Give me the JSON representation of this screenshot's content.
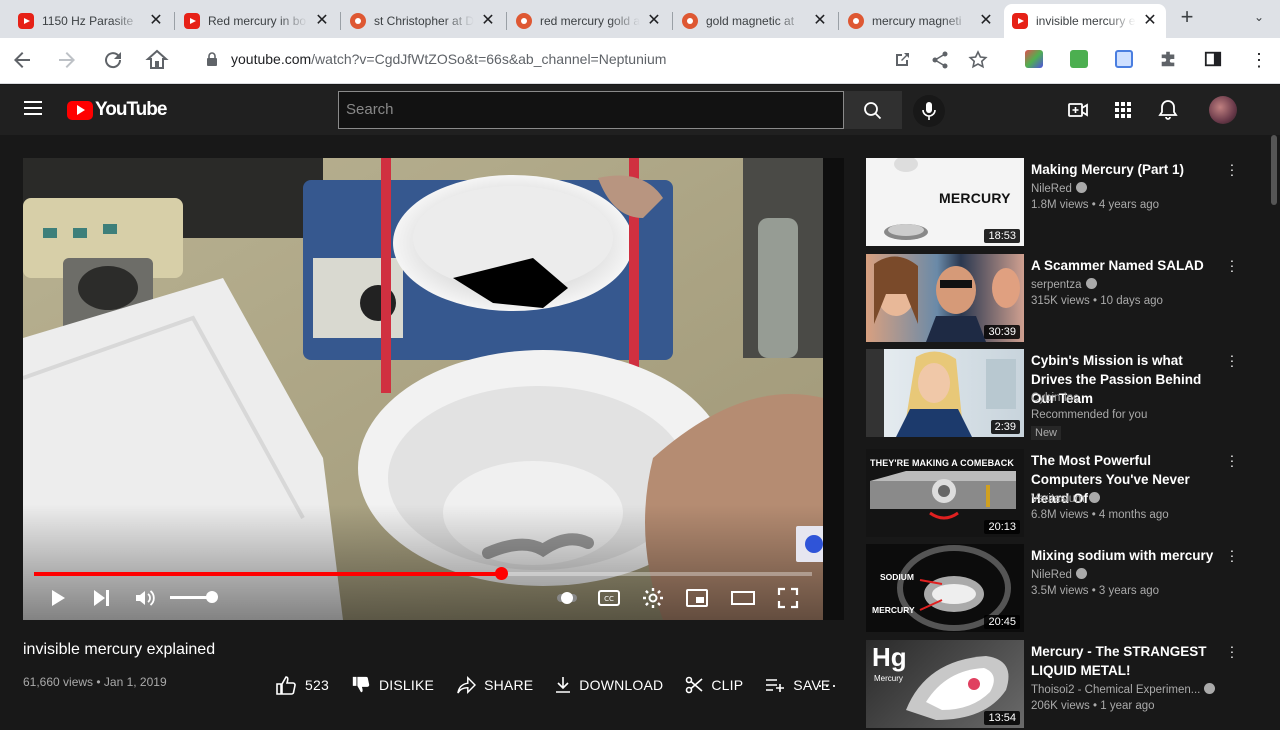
{
  "browser": {
    "tabs": [
      {
        "title": "1150 Hz Parasite",
        "icon": "youtube"
      },
      {
        "title": "Red mercury in bo",
        "icon": "youtube"
      },
      {
        "title": "st Christopher at D",
        "icon": "duckduckgo"
      },
      {
        "title": "red mercury gold a",
        "icon": "duckduckgo"
      },
      {
        "title": "gold magnetic at",
        "icon": "duckduckgo"
      },
      {
        "title": "mercury magneti",
        "icon": "duckduckgo"
      },
      {
        "title": "invisible mercury e",
        "icon": "youtube",
        "active": true
      }
    ],
    "url_host": "youtube.com",
    "url_rest": "/watch?v=CgdJfWtZOSo&t=66s&ab_channel=Neptunium"
  },
  "youtube": {
    "logo_text": "YouTube",
    "search_placeholder": "Search"
  },
  "video": {
    "title": "invisible mercury explained",
    "meta": "61,660 views • Jan 1, 2019",
    "progress": 0.6,
    "volume": 0.85,
    "actions": {
      "likes": "523",
      "dislike": "DISLIKE",
      "share": "SHARE",
      "download": "DOWNLOAD",
      "clip": "CLIP",
      "save": "SAVE"
    }
  },
  "recommendations": [
    {
      "title": "Making Mercury (Part 1)",
      "channel": "NileRed",
      "verified": true,
      "stats": "1.8M views • 4 years ago",
      "duration": "18:53",
      "thumb_text": "MERCURY"
    },
    {
      "title": "A Scammer Named SALAD",
      "channel": "serpentza",
      "verified": true,
      "stats": "315K views • 10 days ago",
      "duration": "30:39"
    },
    {
      "title": "Cybin's Mission is what Drives the Passion Behind Our Team",
      "channel": "Cybin Inc",
      "verified": false,
      "stats": "Recommended for you",
      "duration": "2:39",
      "badge": "New"
    },
    {
      "title": "The Most Powerful Computers You've Never Heard Of",
      "channel": "Veritasium",
      "verified": true,
      "stats": "6.8M views • 4 months ago",
      "duration": "20:13",
      "thumb_text": "THEY'RE MAKING A COMEBACK"
    },
    {
      "title": "Mixing sodium with mercury",
      "channel": "NileRed",
      "verified": true,
      "stats": "3.5M views • 3 years ago",
      "duration": "20:45",
      "thumb_text": "SODIUM",
      "thumb_text2": "MERCURY"
    },
    {
      "title": "Mercury - The STRANGEST LIQUID METAL!",
      "channel": "Thoisoi2 - Chemical Experimen...",
      "verified": true,
      "stats": "206K views • 1 year ago",
      "duration": "13:54",
      "thumb_text": "Hg",
      "thumb_text2": "Mercury"
    }
  ]
}
